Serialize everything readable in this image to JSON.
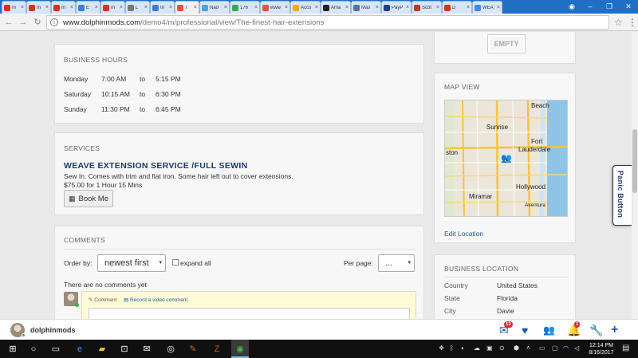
{
  "browser": {
    "tabs": [
      {
        "label": "In",
        "icon": "gmail-icon",
        "color": "#d93025"
      },
      {
        "label": "In",
        "icon": "gmail-icon",
        "color": "#d93025"
      },
      {
        "label": "In",
        "icon": "gmail-icon",
        "color": "#d93025"
      },
      {
        "label": "E",
        "icon": "infinity-icon",
        "color": "#3b7dd8"
      },
      {
        "label": "In",
        "icon": "gmail-icon",
        "color": "#d93025"
      },
      {
        "label": "L",
        "icon": "doc-icon",
        "color": "#777777"
      },
      {
        "label": "In",
        "icon": "infinity-icon",
        "color": "#3b7dd8"
      },
      {
        "label": "T",
        "icon": "pause-icon",
        "color": "#e0533f",
        "active": true
      },
      {
        "label": "Nad",
        "icon": "chat-icon",
        "color": "#4aa3df"
      },
      {
        "label": "176",
        "icon": "maps-icon",
        "color": "#34a853"
      },
      {
        "label": "www",
        "icon": "pause-icon",
        "color": "#e0533f"
      },
      {
        "label": "Acco",
        "icon": "sun-icon",
        "color": "#f2a900"
      },
      {
        "label": "Ama",
        "icon": "amazon-icon",
        "color": "#222222"
      },
      {
        "label": "Mas",
        "icon": "doc-icon",
        "color": "#5a6fa8"
      },
      {
        "label": "PayP",
        "icon": "paypal-icon",
        "color": "#1e3f8c"
      },
      {
        "label": "Scot",
        "icon": "flag-icon",
        "color": "#c0392b"
      },
      {
        "label": "D",
        "icon": "video-icon",
        "color": "#d93025"
      },
      {
        "label": "WEA",
        "icon": "google-icon",
        "color": "#4285f4"
      }
    ],
    "close_glyph": "×",
    "url_host": "www.dolphinmods.com",
    "url_path": "/demo4/m/professional/view/The-finest-hair-extensions"
  },
  "business_hours": {
    "heading": "BUSINESS HOURS",
    "rows": [
      {
        "day": "Monday",
        "open": "7:00 AM",
        "sep": "to",
        "close": "5:15 PM"
      },
      {
        "day": "Saturday",
        "open": "10:15 AM",
        "sep": "to",
        "close": "6:30 PM"
      },
      {
        "day": "Sunday",
        "open": "11:30 PM",
        "sep": "to",
        "close": "6:45 PM"
      }
    ]
  },
  "services": {
    "heading": "SERVICES",
    "title": "WEAVE EXTENSION SERVICE /FULL SEWIN",
    "description": "Sew In. Comes with trim and flat iron. Some hair left out to cover extensions.",
    "price": "$75.00 for 1 Hour 15 Mins",
    "book_label": "Book Me"
  },
  "comments": {
    "heading": "COMMENTS",
    "order_label": "Order by:",
    "order_value": "newest first",
    "expand_label": "expand all",
    "per_page_label": "Per page:",
    "per_page_value": "...",
    "empty_text": "There are no comments yet",
    "comment_tab": "Comment",
    "video_tab": "Record a video comment"
  },
  "sidebar": {
    "empty_label": "EMPTY",
    "map_heading": "MAP VIEW",
    "map_labels": {
      "beach": "Beach",
      "sunrise": "Sunrise",
      "fort": "Fort",
      "lauderdale": "Lauderdale",
      "ston": "ston",
      "hollywood": "Hollywood",
      "miramar": "Miramar",
      "aventura": "Aventura"
    },
    "edit_location": "Edit Location",
    "location_heading": "BUSINESS LOCATION",
    "location": [
      {
        "key": "Country",
        "value": "United States"
      },
      {
        "key": "State",
        "value": "Florida"
      },
      {
        "key": "City",
        "value": "Davie"
      }
    ]
  },
  "panic_label": "Panic Button",
  "sitebar": {
    "username": "dolphinmods",
    "mail_badge": "13",
    "notif_badge": "1"
  },
  "taskbar": {
    "time": "12:14 PM",
    "date": "8/16/2017"
  },
  "colors": {
    "chrome_blue": "#1f6fc5",
    "service_title": "#1a3a6b",
    "link": "#1a5aa6",
    "comment_bg": "#fffbd6",
    "badge": "#d9272e",
    "online": "#37b24d"
  }
}
